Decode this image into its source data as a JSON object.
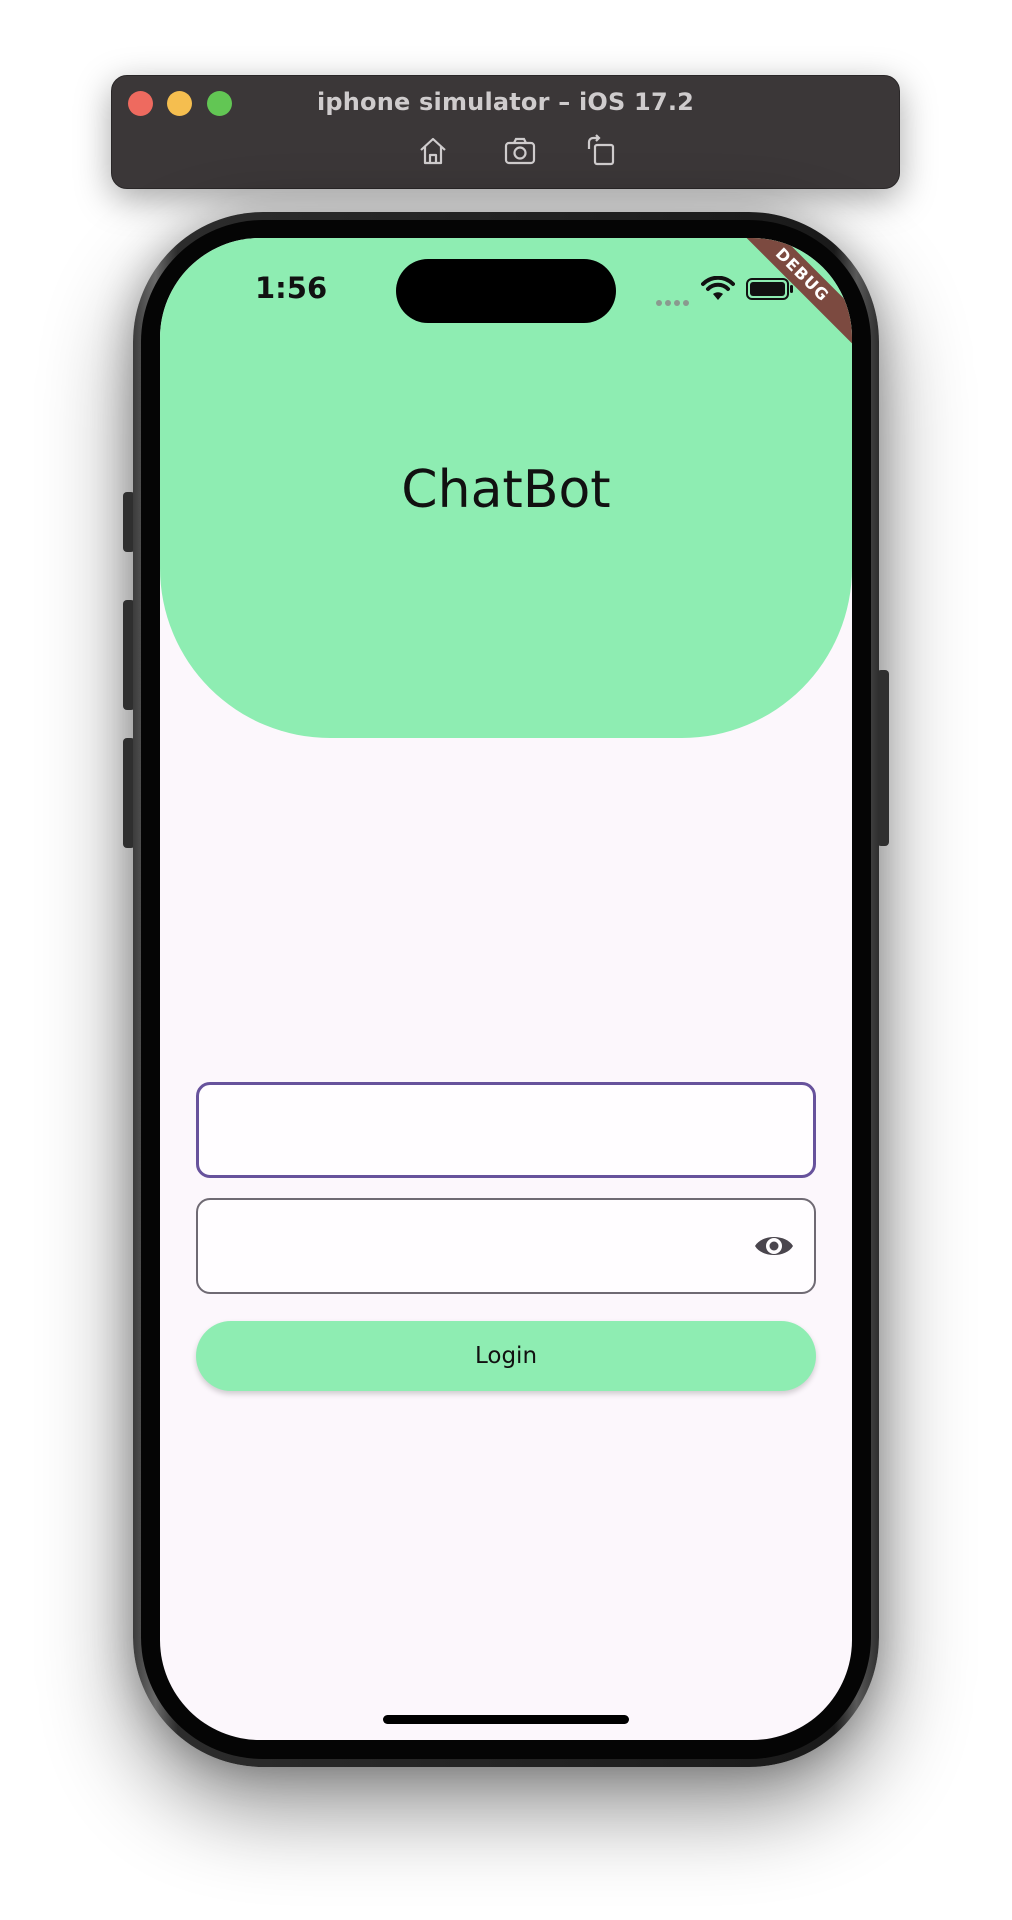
{
  "simulator": {
    "title": "iphone simulator – iOS 17.2",
    "toolbar": [
      "home-icon",
      "screenshot-icon",
      "rotate-icon"
    ]
  },
  "status_bar": {
    "time": "1:56",
    "icons": [
      "cellular-dots-icon",
      "wifi-icon",
      "battery-icon"
    ]
  },
  "debug_banner": {
    "label": "DEBUG"
  },
  "app": {
    "title": "ChatBot",
    "colors": {
      "header": "#8eedb2",
      "background": "#fcf7fc",
      "focused_border": "#67529c",
      "button": "#8eedb2"
    }
  },
  "login_form": {
    "username_value": "",
    "password_value": "",
    "visibility_icon": "eye-icon",
    "login_label": "Login"
  }
}
